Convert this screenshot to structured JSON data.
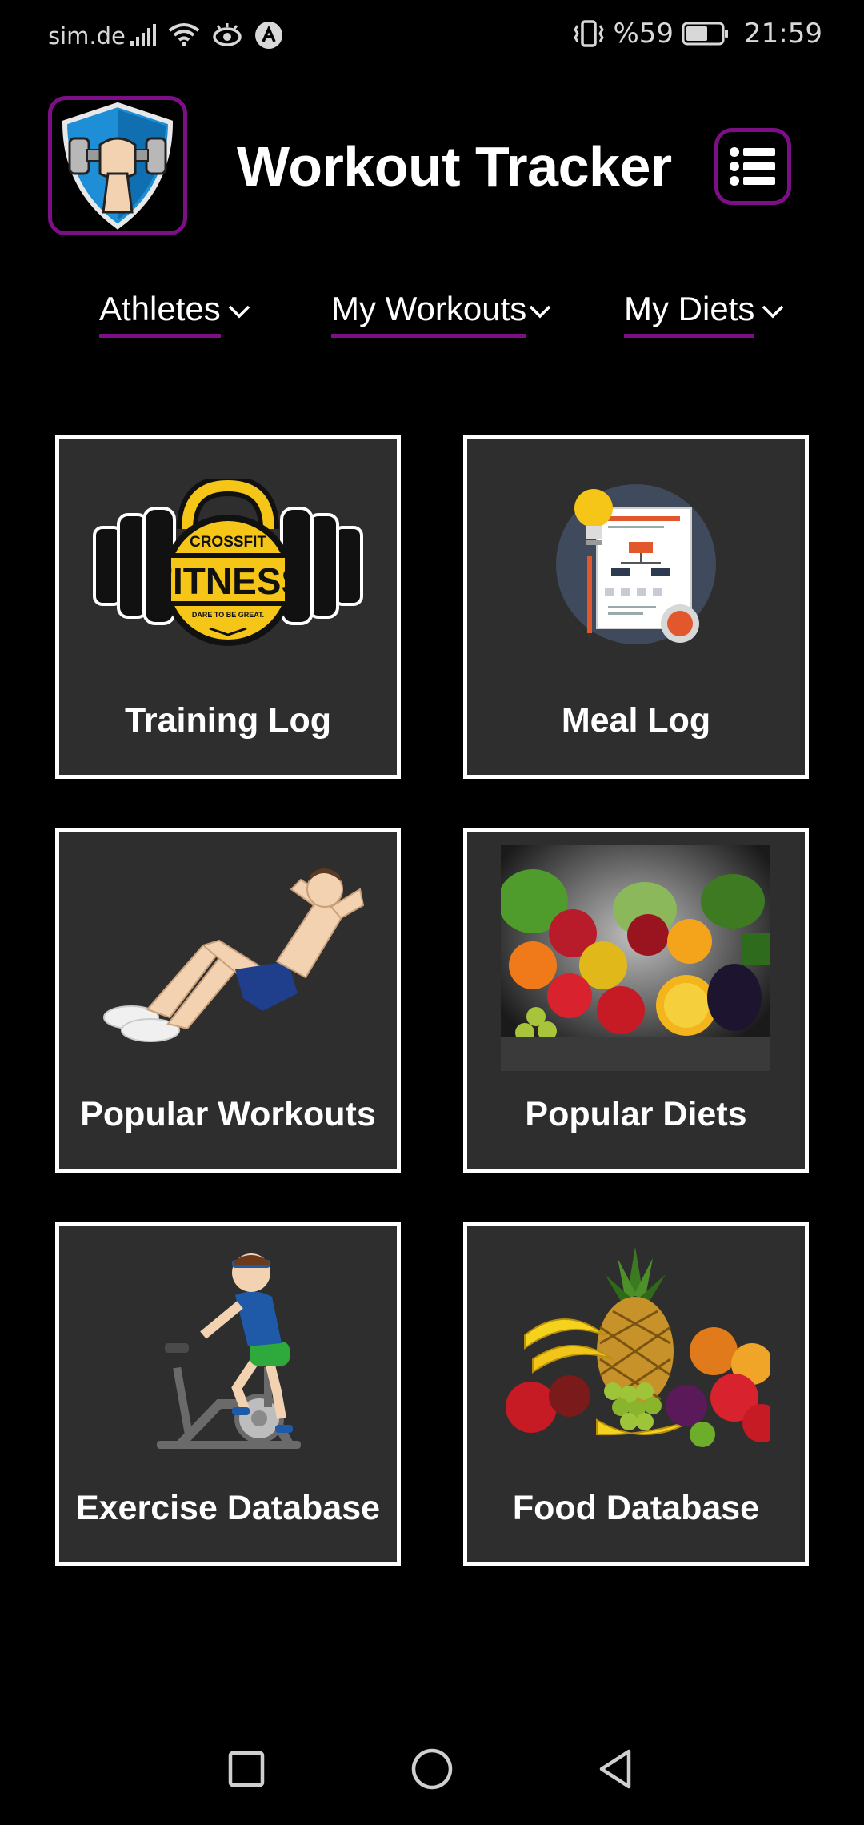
{
  "status_bar": {
    "carrier": "sim.de",
    "battery": "%59",
    "time": "21:59",
    "icons": [
      "signal-icon",
      "wifi-icon",
      "eye-comfort-icon",
      "app-notification-icon",
      "vibrate-icon",
      "battery-icon"
    ]
  },
  "header": {
    "title": "Workout Tracker",
    "logo_icon": "fist-dumbbell-shield-logo",
    "menu_icon": "list-menu-icon"
  },
  "nav_tabs": [
    {
      "label": "Athletes"
    },
    {
      "label": "My Workouts"
    },
    {
      "label": "My Diets"
    }
  ],
  "cards": [
    {
      "title": "Training Log",
      "image": "crossfit-kettlebell-badge"
    },
    {
      "title": "Meal Log",
      "image": "document-planner-illustration"
    },
    {
      "title": "Popular Workouts",
      "image": "situp-man-illustration"
    },
    {
      "title": "Popular Diets",
      "image": "vegetables-fruit-photo"
    },
    {
      "title": "Exercise Database",
      "image": "exercise-bike-illustration"
    },
    {
      "title": "Food Database",
      "image": "fruit-pile-photo"
    }
  ],
  "badge_text": {
    "top": "CROSSFIT",
    "main": "FITNESS",
    "tagline": "DARE TO BE GREAT."
  },
  "colors": {
    "background": "#000000",
    "accent": "#7d0f86",
    "card_bg": "#2e2e2e",
    "card_border": "#ffffff",
    "badge_yellow": "#f5c518"
  },
  "system_nav": [
    "recents-square-icon",
    "home-circle-icon",
    "back-triangle-icon"
  ]
}
